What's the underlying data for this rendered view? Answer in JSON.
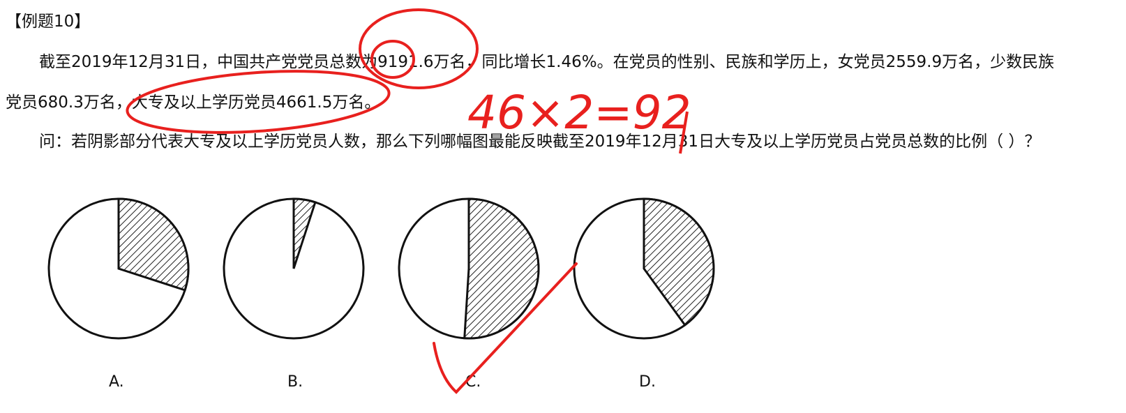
{
  "title": "【例题10】",
  "paragraph1_line1": "截至2019年12月31日，中国共产党党员总数为9191.6万名，同比增长1.46%。在党员的性别、民族和学历上，女党员2559.9万名，少数民族",
  "paragraph1_line2": "党员680.3万名，大专及以上学历党员4661.5万名。",
  "question": "问：若阴影部分代表大专及以上学历党员人数，那么下列哪幅图最能反映截至2019年12月31日大专及以上学历党员占党员总数的比例（    ）？",
  "options": [
    {
      "label": "A.",
      "shaded_fraction": 0.3
    },
    {
      "label": "B.",
      "shaded_fraction": 0.05
    },
    {
      "label": "C.",
      "shaded_fraction": 0.51
    },
    {
      "label": "D.",
      "shaded_fraction": 0.4
    }
  ],
  "annotation": {
    "handwritten_text": "46×2=92",
    "color": "#e8201e"
  }
}
